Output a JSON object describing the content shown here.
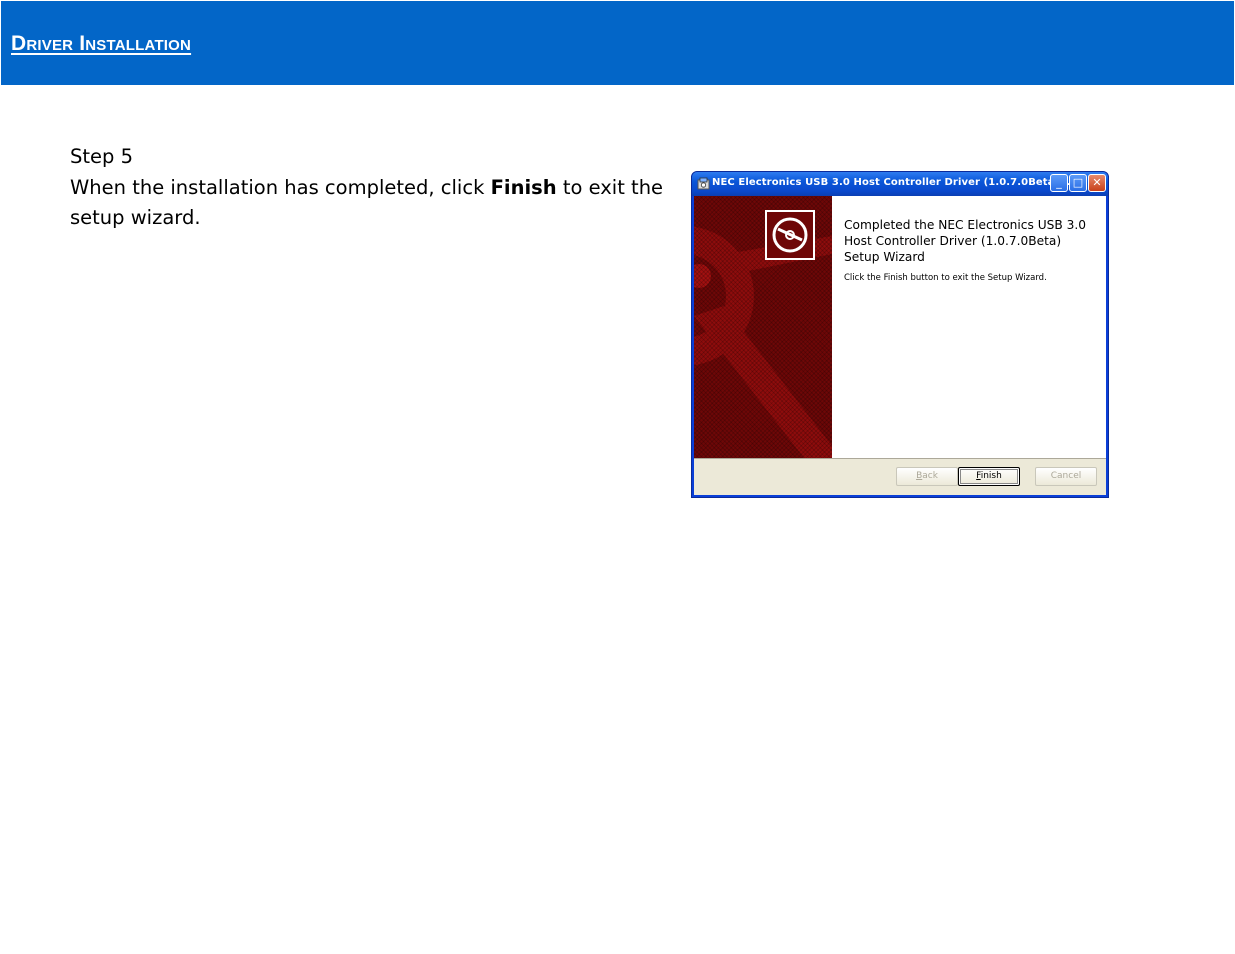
{
  "header": {
    "title": "Driver Installation"
  },
  "step": {
    "number": "Step 5",
    "text_before": "When the installation has completed, click ",
    "text_bold": "Finish",
    "text_after": " to exit the setup wizard."
  },
  "dialog": {
    "title": "NEC Electronics USB 3.0 Host Controller Driver (1.0.7.0Beta) ...",
    "heading": "Completed the NEC Electronics USB 3.0 Host Controller Driver (1.0.7.0Beta) Setup Wizard",
    "description": "Click the Finish button to exit the Setup Wizard.",
    "buttons": {
      "back": {
        "accel": "B",
        "rest": "ack",
        "enabled": false
      },
      "finish": {
        "accel": "F",
        "rest": "inish",
        "enabled": true
      },
      "cancel": {
        "label": "Cancel",
        "enabled": false
      }
    },
    "titlebar_buttons": {
      "minimize": "_",
      "maximize": "□",
      "close": "✕"
    },
    "colors": {
      "header_blue": "#0366c8",
      "banner": "#6e0707",
      "titlebar": "#0a56d8"
    }
  }
}
